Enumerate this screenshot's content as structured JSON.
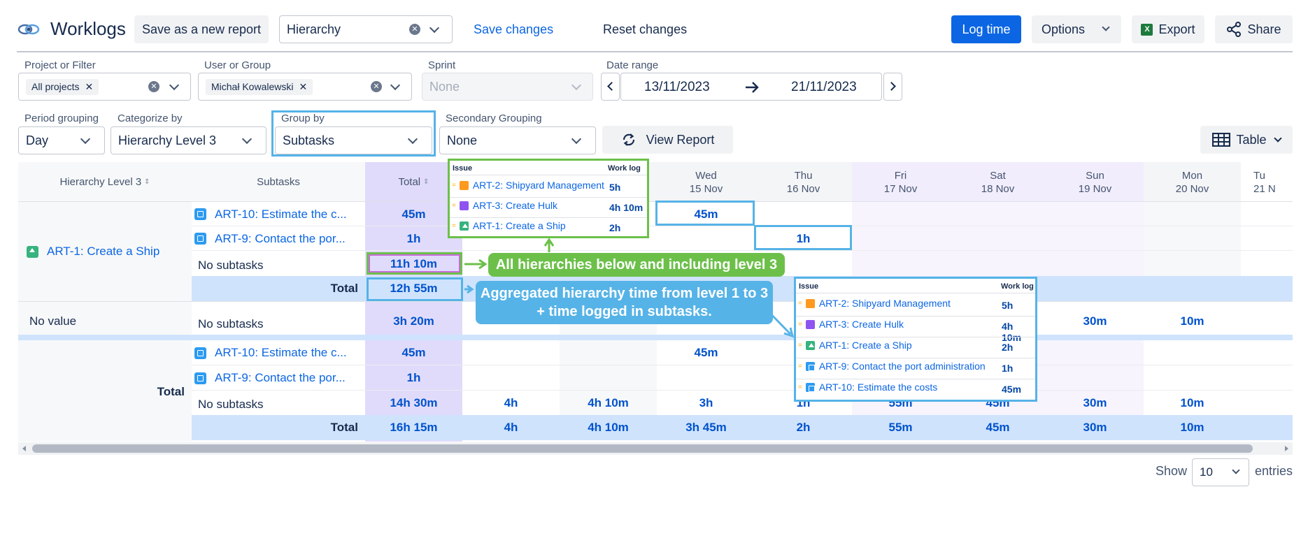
{
  "header": {
    "title": "Worklogs",
    "save_new_report": "Save as a new report",
    "report_select": "Hierarchy",
    "save_changes": "Save changes",
    "reset_changes": "Reset changes",
    "log_time": "Log time",
    "options": "Options",
    "export": "Export",
    "share": "Share"
  },
  "filters": {
    "project_label": "Project or Filter",
    "project_tag": "All projects",
    "user_label": "User or Group",
    "user_tag": "Michał Kowalewski",
    "sprint_label": "Sprint",
    "sprint_placeholder": "None",
    "date_label": "Date range",
    "date_from": "13/11/2023",
    "date_to": "21/11/2023",
    "period_label": "Period grouping",
    "period_value": "Day",
    "categorize_label": "Categorize by",
    "categorize_value": "Hierarchy Level 3",
    "group_label": "Group by",
    "group_value": "Subtasks",
    "secondary_label": "Secondary Grouping",
    "secondary_value": "None",
    "view_report": "View Report",
    "table_view": "Table"
  },
  "table": {
    "col_hierarchy": "Hierarchy Level 3",
    "col_subtasks": "Subtasks",
    "col_total": "Total",
    "days": [
      {
        "d": "Wed",
        "date": "15 Nov"
      },
      {
        "d": "Thu",
        "date": "16 Nov"
      },
      {
        "d": "Fri",
        "date": "17 Nov"
      },
      {
        "d": "Sat",
        "date": "18 Nov"
      },
      {
        "d": "Sun",
        "date": "19 Nov"
      },
      {
        "d": "Mon",
        "date": "20 Nov"
      },
      {
        "d": "Tu",
        "date": "21 N"
      }
    ],
    "group1_name": "ART-1: Create a Ship",
    "sub_art10": "ART-10: Estimate the c...",
    "sub_art9": "ART-9: Contact the por...",
    "no_subtasks": "No subtasks",
    "total_label": "Total",
    "no_value": "No value",
    "g1_art10_total": "45m",
    "g1_art10_wed": "45m",
    "g1_art9_total": "1h",
    "g1_art9_thu": "1h",
    "g1_nosub_total": "11h 10m",
    "g1_total": "12h 55m",
    "nv_total": "3h 20m",
    "nv_sun": "30m",
    "nv_mon": "10m",
    "t_art10_total": "45m",
    "t_art10_wed": "45m",
    "t_art9_total": "1h",
    "t_nosub": {
      "total": "14h 30m",
      "c1": "4h",
      "c2": "4h 10m",
      "wed": "3h",
      "thu": "1h",
      "fri": "55m",
      "sat": "45m",
      "sun": "30m",
      "mon": "10m"
    },
    "t_total": {
      "total": "16h 15m",
      "c1": "4h",
      "c2": "4h 10m",
      "wed": "3h 45m",
      "thu": "2h",
      "fri": "55m",
      "sat": "45m",
      "sun": "30m",
      "mon": "10m"
    }
  },
  "popup1": {
    "h_issue": "Issue",
    "h_worklog": "Work log",
    "rows": [
      {
        "issue": "ART-2: Shipyard Management",
        "time": "5h"
      },
      {
        "issue": "ART-3: Create Hulk",
        "time": "4h 10m"
      },
      {
        "issue": "ART-1: Create a Ship",
        "time": "2h"
      }
    ]
  },
  "popup2": {
    "h_issue": "Issue",
    "h_worklog": "Work log",
    "rows": [
      {
        "issue": "ART-2: Shipyard Management",
        "time": "5h"
      },
      {
        "issue": "ART-3: Create Hulk",
        "time": "4h 10m"
      },
      {
        "issue": "ART-1: Create a Ship",
        "time": "2h"
      },
      {
        "issue": "ART-9: Contact the port administration",
        "time": "1h"
      },
      {
        "issue": "ART-10: Estimate the costs",
        "time": "45m"
      }
    ]
  },
  "callouts": {
    "green": "All hierarchies below and including level 3",
    "blue": "Aggregated hierarchy time from level 1 to 3 + time logged in subtasks."
  },
  "footer": {
    "show": "Show",
    "entries_value": "10",
    "entries": "entries"
  },
  "colors": {
    "primary": "#0c66e4",
    "callout_green": "#6cc04a",
    "callout_blue": "#56b3e7",
    "total_col": "#e0dbfb",
    "total_row": "#cfe3fd"
  }
}
